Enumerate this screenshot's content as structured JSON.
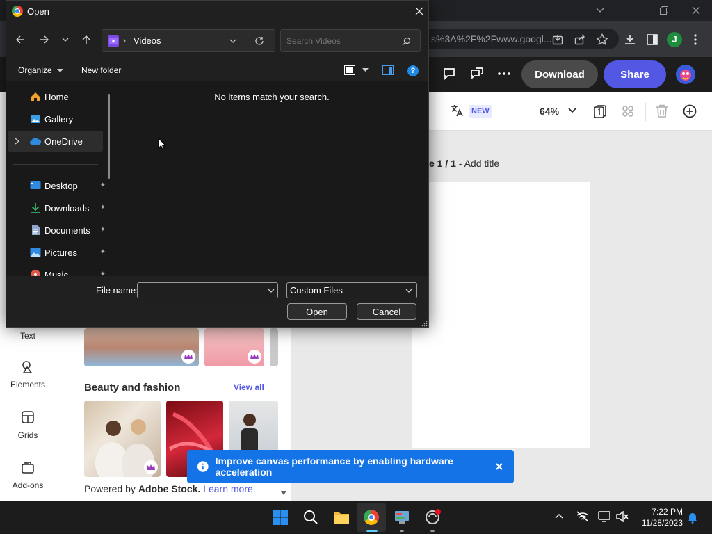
{
  "browser": {
    "url_fragment": "s%3A%2F%2Fwww.googl...",
    "profile_initial": "J",
    "accent": "#1e8e3e"
  },
  "adobe": {
    "download_label": "Download",
    "share_label": "Share",
    "new_badge": "NEW",
    "zoom_level": "64%",
    "page_label_prefix": "e 1 / 1",
    "page_label_title": "Add title",
    "rail": [
      {
        "label": "Text",
        "icon": "text-icon"
      },
      {
        "label": "Elements",
        "icon": "elements-icon"
      },
      {
        "label": "Grids",
        "icon": "grids-icon"
      },
      {
        "label": "Add-ons",
        "icon": "add-ons-icon"
      }
    ],
    "section_title": "Beauty and fashion",
    "view_all": "View all",
    "powered_by_prefix": "Powered by ",
    "powered_by_brand": "Adobe Stock.",
    "learn_more": "Learn more.",
    "toast_message": "Improve canvas performance by enabling hardware acceleration",
    "primary_color": "#5258e4",
    "toast_color": "#1473e6"
  },
  "dialog": {
    "title": "Open",
    "location": "Videos",
    "search_placeholder": "Search Videos",
    "organize_label": "Organize",
    "new_folder_label": "New folder",
    "empty_message": "No items match your search.",
    "nav": [
      {
        "label": "Home",
        "icon": "home-icon",
        "pinned": false
      },
      {
        "label": "Gallery",
        "icon": "gallery-icon",
        "pinned": false
      },
      {
        "label": "OneDrive",
        "icon": "onedrive-icon",
        "pinned": false,
        "selected": true
      },
      {
        "label": "Desktop",
        "icon": "desktop-icon",
        "pinned": true
      },
      {
        "label": "Downloads",
        "icon": "downloads-icon",
        "pinned": true
      },
      {
        "label": "Documents",
        "icon": "documents-icon",
        "pinned": true
      },
      {
        "label": "Pictures",
        "icon": "pictures-icon",
        "pinned": true
      },
      {
        "label": "Music",
        "icon": "music-icon",
        "pinned": true
      }
    ],
    "file_name_label": "File name:",
    "file_name_value": "",
    "file_type": "Custom Files",
    "open_label": "Open",
    "cancel_label": "Cancel"
  },
  "taskbar": {
    "time": "7:22 PM",
    "date": "11/28/2023"
  }
}
